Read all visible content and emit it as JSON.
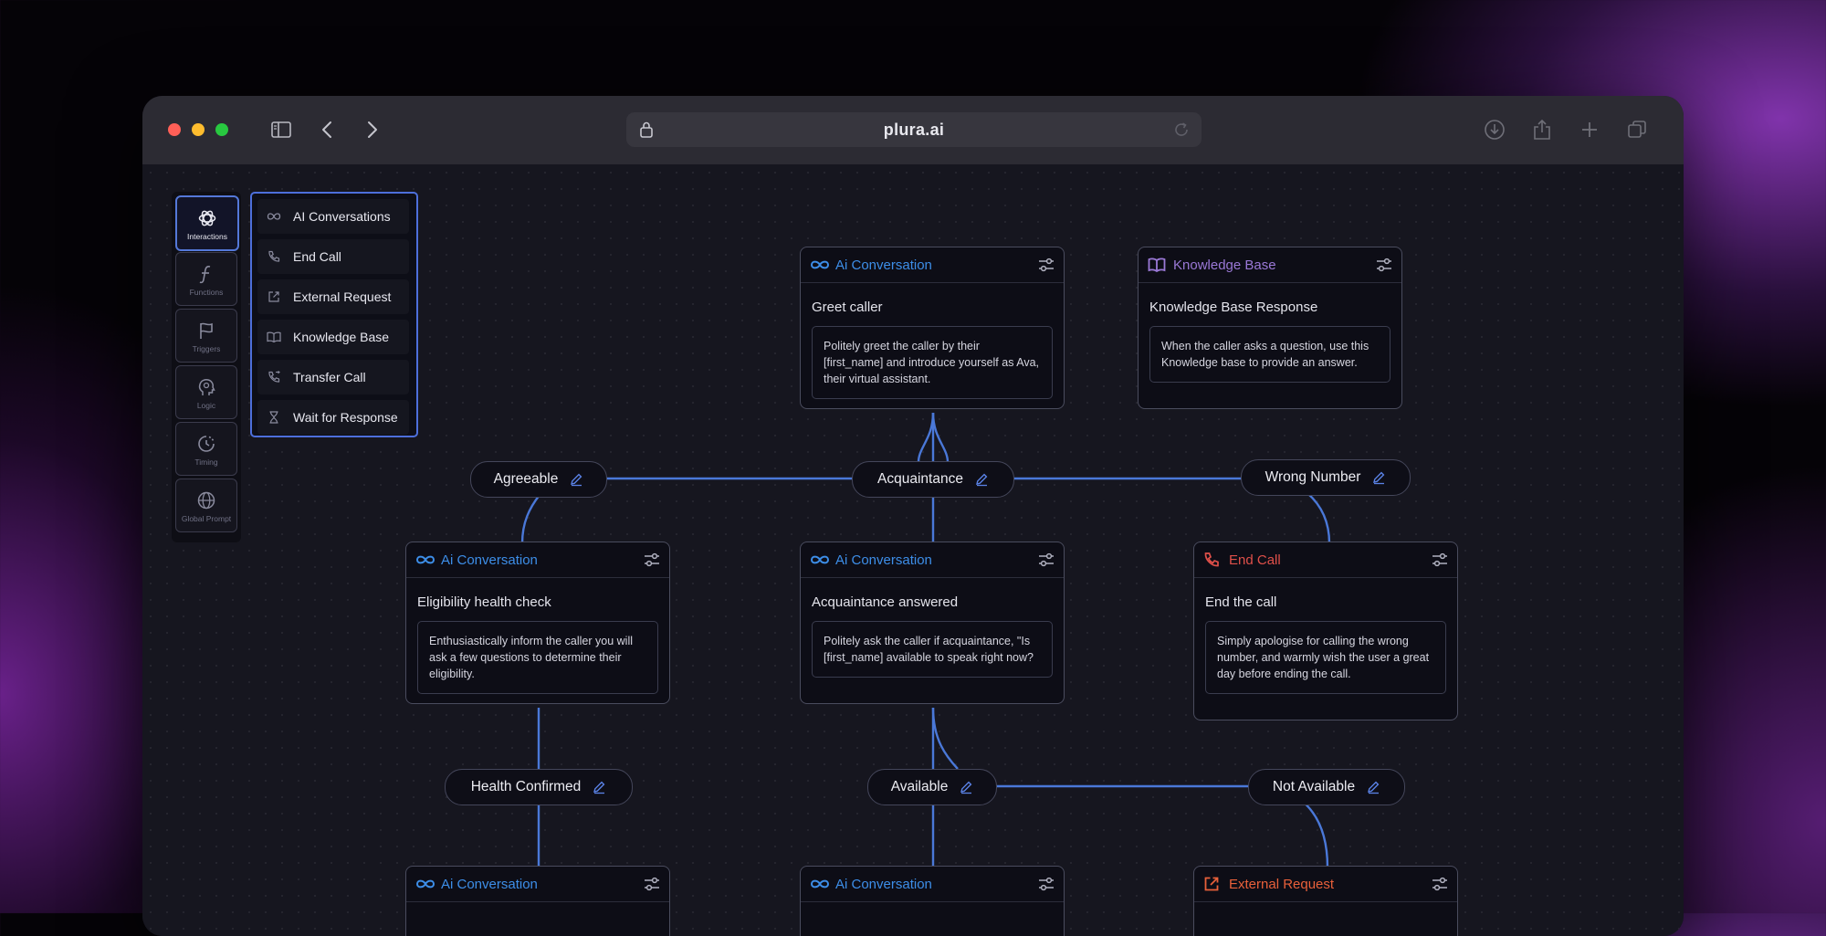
{
  "browser": {
    "url": "plura.ai",
    "traffic_lights": [
      "#ff5f57",
      "#febc2e",
      "#28c840"
    ]
  },
  "toolbar": [
    {
      "label": "Interactions",
      "icon": "openai-logo-icon",
      "active": true
    },
    {
      "label": "Functions",
      "icon": "function-icon",
      "active": false
    },
    {
      "label": "Triggers",
      "icon": "flag-icon",
      "active": false
    },
    {
      "label": "Logic",
      "icon": "head-brain-icon",
      "active": false
    },
    {
      "label": "Timing",
      "icon": "clock-icon",
      "active": false
    },
    {
      "label": "Global Prompt",
      "icon": "globe-icon",
      "active": false
    }
  ],
  "menu": [
    {
      "label": "AI Conversations",
      "icon": "infinity-icon"
    },
    {
      "label": "End Call",
      "icon": "phone-icon"
    },
    {
      "label": "External Request",
      "icon": "external-link-icon"
    },
    {
      "label": "Knowledge Base",
      "icon": "book-icon"
    },
    {
      "label": "Transfer Call",
      "icon": "phone-forward-icon"
    },
    {
      "label": "Wait for Response",
      "icon": "hourglass-icon"
    }
  ],
  "nodes": {
    "greet": {
      "type": "Ai Conversation",
      "title": "Greet caller",
      "description": "Politely greet the caller by their [first_name] and introduce yourself as Ava, their virtual assistant."
    },
    "kb": {
      "type": "Knowledge Base",
      "title": "Knowledge Base Response",
      "description": "When the caller asks a question, use this Knowledge base to provide an answer."
    },
    "eligibility": {
      "type": "Ai Conversation",
      "title": "Eligibility health check",
      "description": "Enthusiastically inform the caller you will ask a few questions to determine their eligibility."
    },
    "acq": {
      "type": "Ai Conversation",
      "title": "Acquaintance answered",
      "description": "Politely ask the caller if acquaintance, \"Is [first_name] available to speak right now?"
    },
    "endcall": {
      "type": "End Call",
      "title": "End the call",
      "description": "Simply apologise for calling the wrong number, and warmly wish the user a great day before ending the call."
    },
    "bottom1": {
      "type": "Ai Conversation"
    },
    "bottom2": {
      "type": "Ai Conversation"
    },
    "bottom3": {
      "type": "External Request"
    }
  },
  "branches": {
    "agreeable": "Agreeable",
    "acquaintance": "Acquaintance",
    "wrong_number": "Wrong Number",
    "health_confirmed": "Health Confirmed",
    "available": "Available",
    "not_available": "Not Available"
  },
  "colors": {
    "ai": "#3d8ee8",
    "kb": "#9a78d6",
    "endcall": "#e0504a",
    "external": "#e8603a",
    "edge": "#4a78d8"
  }
}
